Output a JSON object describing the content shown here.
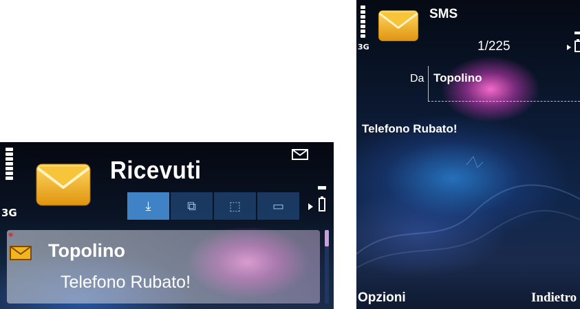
{
  "inbox": {
    "network": "3G",
    "title": "Ricevuti",
    "icons": {
      "app": "envelope-icon",
      "indicator": "new-message-envelope-icon",
      "nav": "arrow-right-icon",
      "battery": "battery-icon"
    },
    "toolbar_tabs": [
      {
        "icon": "download-inbox-icon",
        "glyph": "⤓",
        "active": true
      },
      {
        "icon": "copy-folder-icon",
        "glyph": "⧉",
        "active": false
      },
      {
        "icon": "mark-icon",
        "glyph": "⬚",
        "active": false
      },
      {
        "icon": "card-icon",
        "glyph": "▭",
        "active": false
      }
    ],
    "messages": [
      {
        "sender": "Topolino",
        "preview": "Telefono Rubato!",
        "unread": true,
        "new_mark": "*"
      }
    ]
  },
  "message": {
    "network": "3G",
    "title": "SMS",
    "counter": "1/225",
    "from_label": "Da",
    "from_value": "Topolino",
    "body": "Telefono Rubato!",
    "softkey_left": "Opzioni",
    "softkey_right": "Indietro",
    "icons": {
      "app": "envelope-icon",
      "nav": "arrow-right-icon",
      "battery": "battery-icon"
    }
  },
  "colors": {
    "accent": "#3f82c6",
    "envelope": "#f2b51f",
    "text": "#ffffff"
  }
}
